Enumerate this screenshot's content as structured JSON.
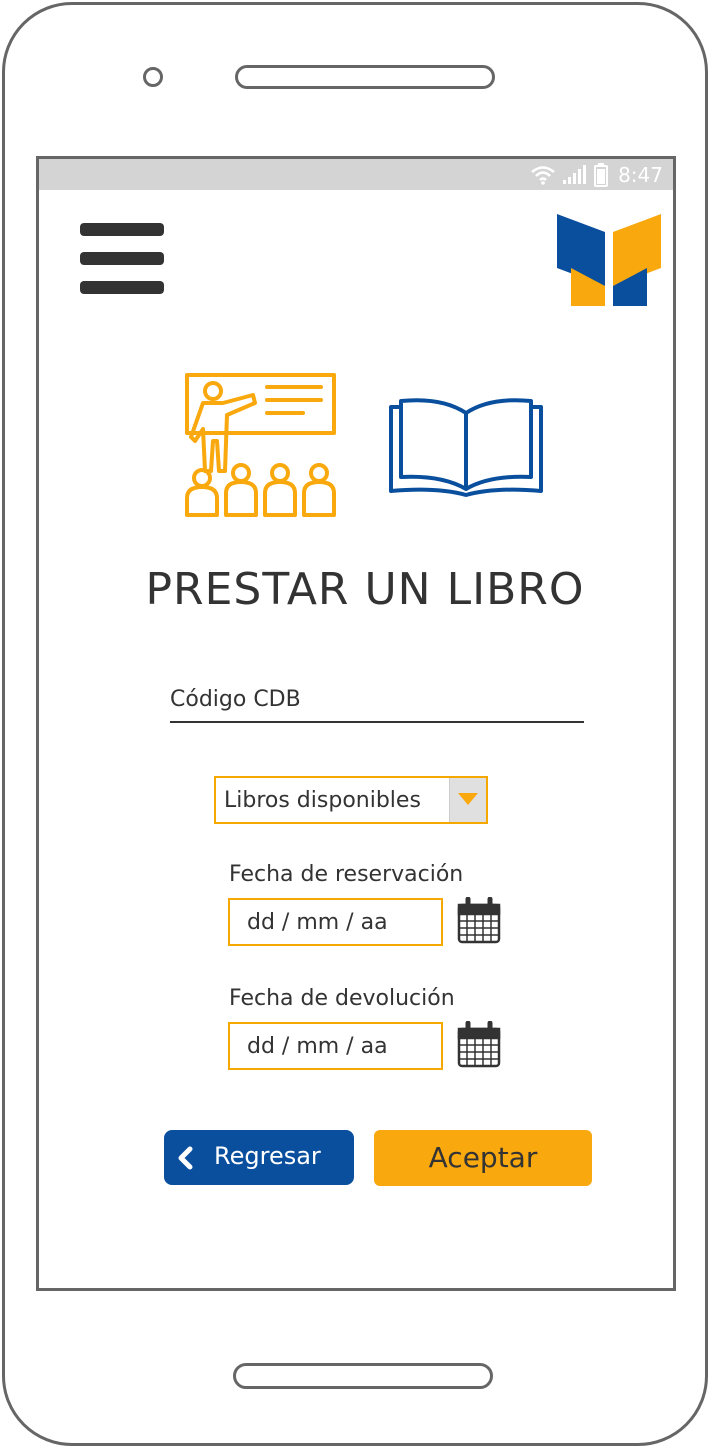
{
  "status_bar": {
    "time": "8:47",
    "icons": [
      "wifi-icon",
      "signal-icon",
      "battery-icon"
    ]
  },
  "header": {
    "menu_icon": "hamburger-menu-icon",
    "logo_icon": "app-book-logo"
  },
  "illustrations": {
    "left": "teacher-classroom-icon",
    "right": "open-book-icon"
  },
  "page_title": "PRESTAR UN LIBRO",
  "form": {
    "codigo_placeholder": "Código CDB",
    "books_dropdown": {
      "selected": "Libros disponibles"
    },
    "reservation_date": {
      "label": "Fecha de reservación",
      "placeholder": "dd / mm / aa"
    },
    "return_date": {
      "label": "Fecha de devolución",
      "placeholder": "dd / mm / aa"
    }
  },
  "buttons": {
    "back_label": "Regresar",
    "accept_label": "Aceptar"
  },
  "colors": {
    "accent_orange": "#f9a80d",
    "brand_blue": "#0a4f9e",
    "text_dark": "#333333",
    "status_bar_gray": "#d4d4d4"
  }
}
